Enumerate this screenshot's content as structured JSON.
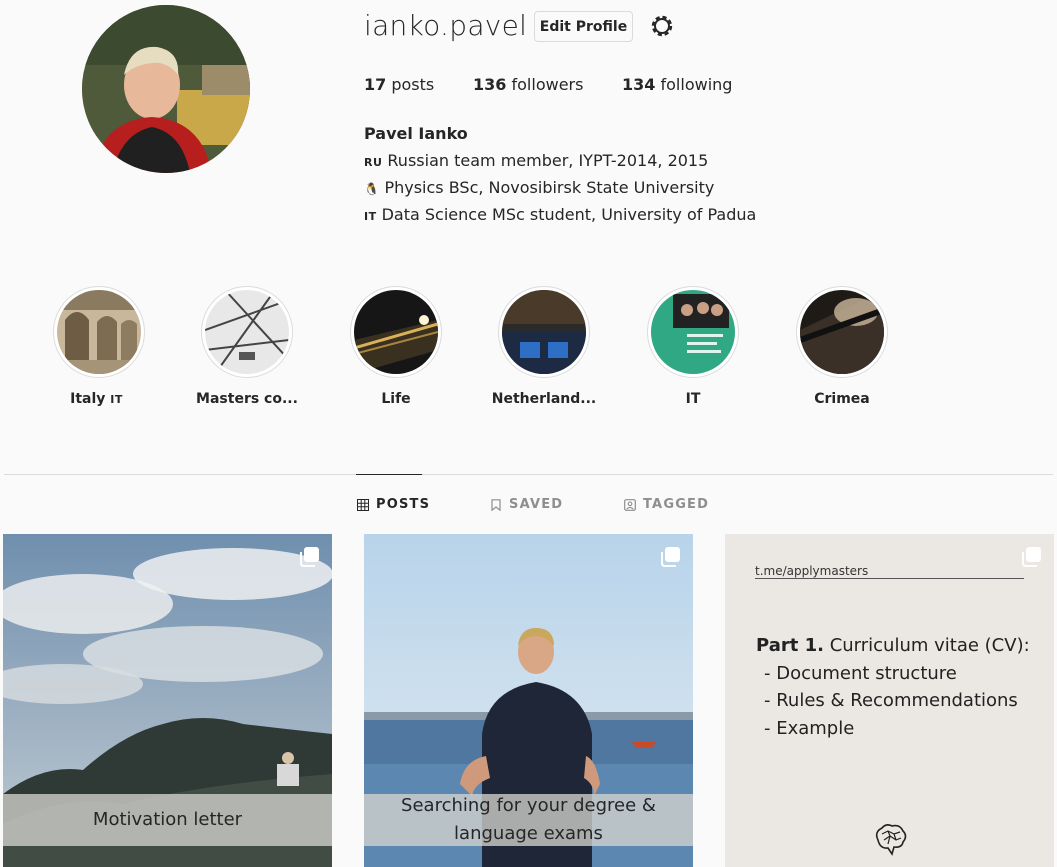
{
  "profile": {
    "username": "ianko.pavel",
    "edit_profile_label": "Edit Profile",
    "full_name": "Pavel Ianko",
    "stats": {
      "posts_count": "17",
      "posts_label": "posts",
      "followers_count": "136",
      "followers_label": "followers",
      "following_count": "134",
      "following_label": "following"
    },
    "bio": [
      {
        "flag": "RU",
        "text": "Russian team member, IYPT-2014, 2015"
      },
      {
        "flag": "🐧",
        "text": "Physics BSc, Novosibirsk State University"
      },
      {
        "flag": "IT",
        "text": "Data Science MSc student, University of Padua"
      }
    ]
  },
  "highlights": [
    {
      "label": "Italy",
      "flag": "IT"
    },
    {
      "label": "Masters co..."
    },
    {
      "label": "Life"
    },
    {
      "label": "Netherland..."
    },
    {
      "label": "IT"
    },
    {
      "label": "Crimea"
    }
  ],
  "tabs": [
    {
      "label": "POSTS",
      "icon": "grid-icon",
      "active": true
    },
    {
      "label": "SAVED",
      "icon": "bookmark-icon",
      "active": false
    },
    {
      "label": "TAGGED",
      "icon": "tag-user-icon",
      "active": false
    }
  ],
  "posts": [
    {
      "caption": "Motivation letter",
      "multi": true
    },
    {
      "caption_line1": "Searching for your degree &",
      "caption_line2": "language exams",
      "multi": true
    },
    {
      "url": "t.me/applymasters",
      "part_bold": "Part 1.",
      "part_rest": " Curriculum vitae (CV):",
      "items": [
        "- Document structure",
        "- Rules & Recommendations",
        "- Example"
      ],
      "multi": true
    }
  ],
  "colors": {
    "text": "#262626",
    "muted": "#8e8e8e",
    "border": "#dbdbdb",
    "background": "#fafafa"
  }
}
